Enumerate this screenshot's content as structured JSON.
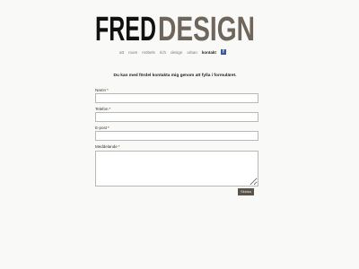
{
  "brand": {
    "logo_text_dark": "FRED",
    "logo_text_light": "DESIGN",
    "colors": {
      "dark": "#111111",
      "accent": "#6e665b"
    }
  },
  "nav": {
    "items": [
      {
        "label": "att"
      },
      {
        "label": "room"
      },
      {
        "label": "möbels"
      },
      {
        "label": "rich"
      },
      {
        "label": "design"
      },
      {
        "label": "urban"
      },
      {
        "label": "kontakt"
      }
    ],
    "facebook_icon": "facebook-icon",
    "facebook_glyph": "f"
  },
  "intro_text": "Du kan med fördel kontakta mig genom att fylla i formuläret.",
  "form": {
    "name_label": "Namn",
    "phone_label": "Telefon",
    "email_label": "E-post",
    "message_label": "Meddelande",
    "required_mark": "*",
    "name_value": "",
    "phone_value": "",
    "email_value": "",
    "message_value": "",
    "submit_label": "Skicka"
  }
}
